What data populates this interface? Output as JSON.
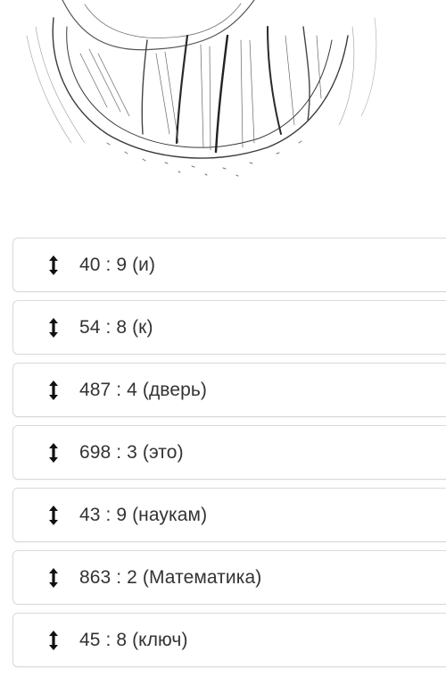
{
  "items": [
    {
      "label": "40 : 9 (и)"
    },
    {
      "label": "54 : 8 (к)"
    },
    {
      "label": "487 : 4 (дверь)"
    },
    {
      "label": "698 : 3 (это)"
    },
    {
      "label": "43 : 9 (наукам)"
    },
    {
      "label": "863 : 2 (Математика)"
    },
    {
      "label": "45 : 8 (ключ)"
    }
  ],
  "colors": {
    "card_border": "#d9d9d9",
    "text": "#333333",
    "handle": "#111111"
  },
  "icons": {
    "drag_handle": "vertical-double-arrow-icon"
  }
}
